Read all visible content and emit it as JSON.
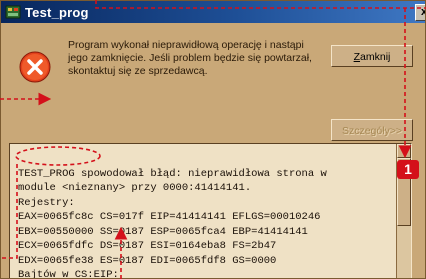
{
  "window": {
    "title": "Test_prog",
    "close_glyph": "x"
  },
  "dialog": {
    "message": "Program wykonał nieprawidłową operację i nastąpi jego zamknięcie. Jeśli problem będzie się powtarzał, skontaktuj się ze sprzedawcą.",
    "close_button": "Zamknij",
    "close_button_accel": "Z",
    "close_button_rest": "amknij",
    "details_button": "Szczegóły>>"
  },
  "details": {
    "lines": [
      "TEST_PROG spowodował błąd: nieprawidłowa strona w",
      "module <nieznany> przy 0000:41414141.",
      "Rejestry:",
      "EAX=0065fc8c CS=017f EIP=41414141 EFLGS=00010246",
      "EBX=00550000 SS=0187 ESP=0065fca4 EBP=41414141",
      "ECX=0065fdfc DS=0187 ESI=0164eba8 FS=2b47",
      "EDX=0065fe38 ES=0187 EDI=0065fdf8 GS=0000",
      "Bajtów w CS:EIP:"
    ]
  },
  "annotation": {
    "badge_number": "1",
    "accent_color": "#d4101a"
  }
}
